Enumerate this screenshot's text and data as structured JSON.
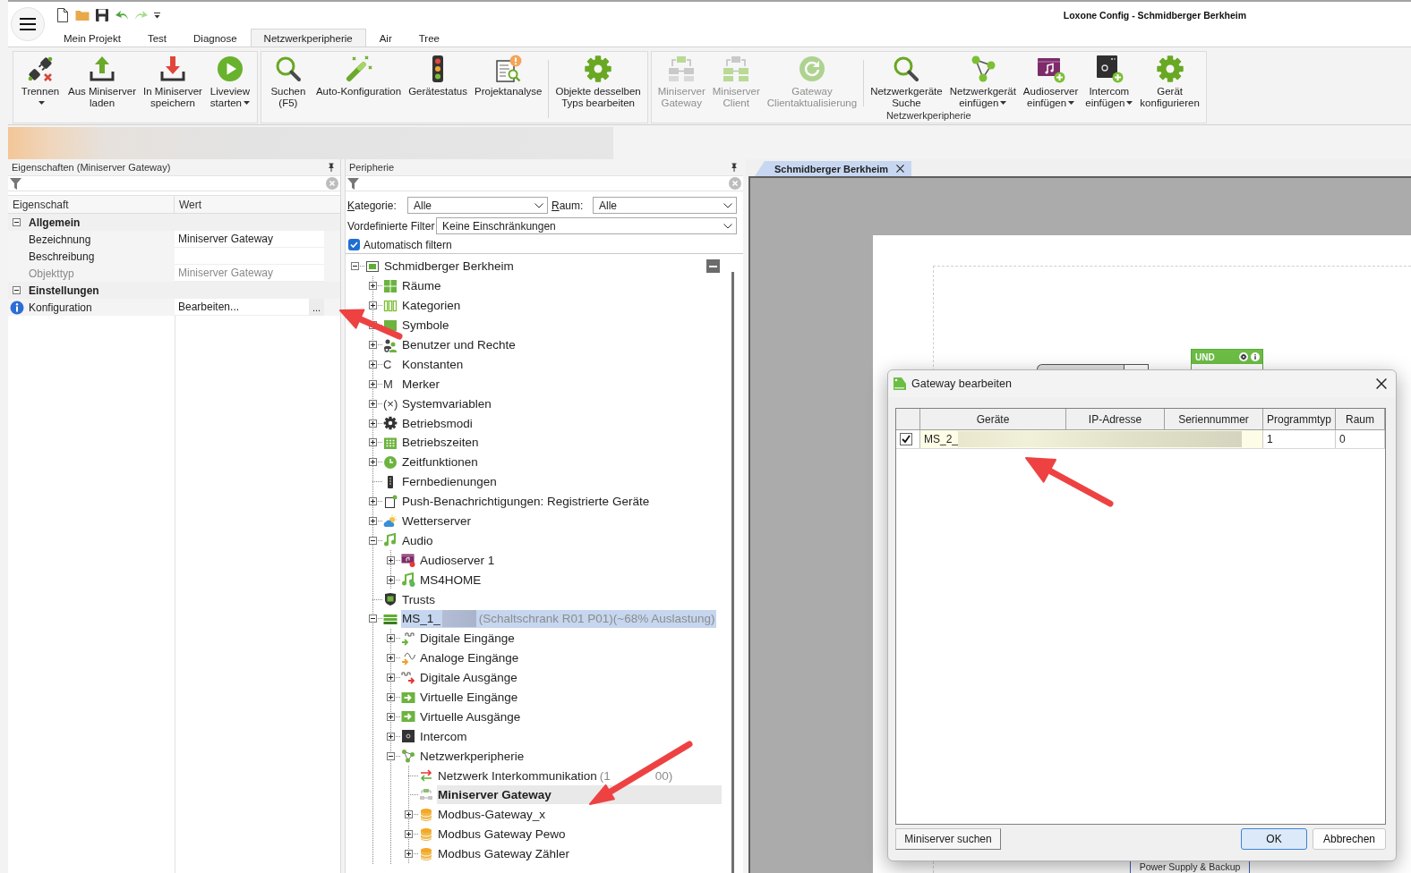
{
  "window": {
    "title": "Loxone Config - Schmidberger Berkheim"
  },
  "ribbon_tabs": [
    {
      "label": "Mein Projekt",
      "selected": false
    },
    {
      "label": "Test",
      "selected": false
    },
    {
      "label": "Diagnose",
      "selected": false
    },
    {
      "label": "Netzwerkperipherie",
      "selected": true
    },
    {
      "label": "Air",
      "selected": false
    },
    {
      "label": "Tree",
      "selected": false
    }
  ],
  "ribbon": {
    "groups": [
      {
        "sections": [
          {
            "buttons": [
              {
                "lines": [
                  "Trennen"
                ],
                "dropdown": true,
                "disabled": false
              },
              {
                "lines": [
                  "Aus Miniserver",
                  "laden"
                ],
                "dropdown": false,
                "disabled": false
              },
              {
                "lines": [
                  "In Miniserver",
                  "speichern"
                ],
                "dropdown": false,
                "disabled": false
              },
              {
                "lines": [
                  "Liveview",
                  "starten"
                ],
                "dropdown": true,
                "disabled": false
              }
            ]
          }
        ]
      },
      {
        "sections": [
          {
            "buttons": [
              {
                "lines": [
                  "Suchen",
                  "(F5)"
                ],
                "dropdown": false,
                "disabled": false
              },
              {
                "lines": [
                  "Auto-Konfiguration"
                ],
                "dropdown": false,
                "disabled": false
              },
              {
                "lines": [
                  "Gerätestatus"
                ],
                "dropdown": false,
                "disabled": false
              },
              {
                "lines": [
                  "Projektanalyse"
                ],
                "dropdown": false,
                "disabled": false
              }
            ]
          },
          {
            "buttons": [
              {
                "lines": [
                  "Objekte desselben",
                  "Typs bearbeiten"
                ],
                "dropdown": false,
                "disabled": false
              }
            ]
          }
        ]
      },
      {
        "label": "Netzwerkperipherie",
        "sections": [
          {
            "buttons": [
              {
                "lines": [
                  "Miniserver",
                  "Gateway"
                ],
                "dropdown": false,
                "disabled": true
              },
              {
                "lines": [
                  "Miniserver",
                  "Client"
                ],
                "dropdown": false,
                "disabled": true
              },
              {
                "lines": [
                  "Gateway",
                  "Clientaktualisierung"
                ],
                "dropdown": false,
                "disabled": true
              }
            ]
          },
          {
            "buttons": [
              {
                "lines": [
                  "Netzwerkgeräte",
                  "Suche"
                ],
                "dropdown": false,
                "disabled": false
              },
              {
                "lines": [
                  "Netzwerkgerät",
                  "einfügen"
                ],
                "dropdown": true,
                "disabled": false
              },
              {
                "lines": [
                  "Audioserver",
                  "einfügen"
                ],
                "dropdown": true,
                "disabled": false
              },
              {
                "lines": [
                  "Intercom",
                  "einfügen"
                ],
                "dropdown": true,
                "disabled": false
              },
              {
                "lines": [
                  "Gerät",
                  "konfigurieren"
                ],
                "dropdown": false,
                "disabled": false
              }
            ]
          }
        ]
      }
    ]
  },
  "properties": {
    "title": "Eigenschaften (Miniserver Gateway)",
    "columns": [
      "Eigenschaft",
      "Wert"
    ],
    "categories": [
      {
        "label": "Allgemein",
        "expanded": true,
        "rows": [
          {
            "kind": "text",
            "name": "Bezeichnung",
            "value": "Miniserver Gateway",
            "disabled": false
          },
          {
            "kind": "text",
            "name": "Beschreibung",
            "disabled": false
          },
          {
            "kind": "text",
            "name": "Objekttyp",
            "value": "Miniserver Gateway",
            "disabled": true
          }
        ]
      },
      {
        "label": "Einstellungen",
        "expanded": true,
        "rows": [
          {
            "kind": "editor",
            "name": "Konfiguration",
            "value": "Bearbeiten...",
            "button": "...",
            "disabled": false
          }
        ]
      }
    ]
  },
  "peripherie": {
    "title": "Peripherie",
    "category_filter": {
      "label": "Kategorie:",
      "value": "Alle"
    },
    "room_filter": {
      "label": "Raum:",
      "value": "Alle"
    },
    "predefined_filter": {
      "label": "Vordefinierte Filter",
      "value": "Keine Einschränkungen"
    },
    "auto_filter": {
      "label": "Automatisch filtern",
      "checked": true
    },
    "tree": [
      {
        "label": "Schmidberger Berkheim",
        "expanded": true,
        "selected": false,
        "highlighted": false,
        "children": [
          {
            "label": "Räume",
            "expanded": false,
            "selected": false,
            "highlighted": false
          },
          {
            "label": "Kategorien",
            "expanded": false,
            "selected": false,
            "highlighted": false
          },
          {
            "label": "Symbole",
            "expanded": false,
            "selected": false,
            "highlighted": false
          },
          {
            "label": "Benutzer und Rechte",
            "expanded": false,
            "selected": false,
            "highlighted": false
          },
          {
            "label": "Konstanten",
            "glyph": "C",
            "expanded": false,
            "selected": false,
            "highlighted": false
          },
          {
            "label": "Merker",
            "glyph": "M",
            "expanded": false,
            "selected": false,
            "highlighted": false
          },
          {
            "label": "Systemvariablen",
            "glyph": "(×)",
            "expanded": false,
            "selected": false,
            "highlighted": false
          },
          {
            "label": "Betriebsmodi",
            "expanded": false,
            "selected": false,
            "highlighted": false
          },
          {
            "label": "Betriebszeiten",
            "expanded": false,
            "selected": false,
            "highlighted": false
          },
          {
            "label": "Zeitfunktionen",
            "expanded": false,
            "selected": false,
            "highlighted": false
          },
          {
            "label": "Fernbedienungen",
            "selected": false,
            "highlighted": false
          },
          {
            "label": "Push-Benachrichtigungen: Registrierte Geräte",
            "expanded": false,
            "selected": false,
            "highlighted": false
          },
          {
            "label": "Wetterserver",
            "expanded": false,
            "selected": false,
            "highlighted": false
          },
          {
            "label": "Audio",
            "expanded": true,
            "selected": false,
            "highlighted": false,
            "children": [
              {
                "label": "Audioserver 1",
                "expanded": false,
                "selected": false,
                "highlighted": false
              },
              {
                "label": "MS4HOME",
                "expanded": false,
                "selected": false,
                "highlighted": false
              }
            ]
          },
          {
            "label": "Trusts",
            "selected": false,
            "highlighted": false
          },
          {
            "label": "MS_1_",
            "redacted": true,
            "note_parts": [
              "(Schaltschrank R01 P01)(~68% Auslastung)"
            ],
            "expanded": true,
            "selected": false,
            "highlighted": true,
            "children": [
              {
                "label": "Digitale Eingänge",
                "expanded": false,
                "selected": false,
                "highlighted": false
              },
              {
                "label": "Analoge Eingänge",
                "expanded": false,
                "selected": false,
                "highlighted": false
              },
              {
                "label": "Digitale Ausgänge",
                "expanded": false,
                "selected": false,
                "highlighted": false
              },
              {
                "label": "Virtuelle Eingänge",
                "expanded": false,
                "selected": false,
                "highlighted": false
              },
              {
                "label": "Virtuelle Ausgänge",
                "expanded": false,
                "selected": false,
                "highlighted": false
              },
              {
                "label": "Intercom",
                "expanded": false,
                "selected": false,
                "highlighted": false
              },
              {
                "label": "Netzwerkperipherie",
                "expanded": true,
                "selected": false,
                "highlighted": false,
                "children": [
                  {
                    "label": "Netzwerk Interkommunikation",
                    "note_parts": [
                      "(1",
                      "00)"
                    ],
                    "selected": false,
                    "highlighted": false
                  },
                  {
                    "label": "Miniserver Gateway",
                    "selected": true,
                    "highlighted": false
                  },
                  {
                    "label": "Modbus-Gateway_x",
                    "expanded": false,
                    "selected": false,
                    "highlighted": false
                  },
                  {
                    "label": "Modbus Gateway Pewo",
                    "expanded": false,
                    "selected": false,
                    "highlighted": false
                  },
                  {
                    "label": "Modbus Gateway Zähler",
                    "expanded": false,
                    "selected": false,
                    "highlighted": false
                  }
                ]
              }
            ]
          }
        ]
      }
    ]
  },
  "document_tabs": [
    {
      "label": "Schmidberger Berkheim",
      "selected": true
    }
  ],
  "canvas": {
    "blocks": [
      {
        "kind": "logic",
        "title": "UND"
      },
      {
        "kind": "input"
      },
      {
        "kind": "label",
        "title": "Power Supply & Backup"
      }
    ]
  },
  "dialog": {
    "title": "Gateway bearbeiten",
    "columns": [
      "Geräte",
      "IP-Adresse",
      "Seriennummer",
      "Programmtyp",
      "Raum"
    ],
    "rows": [
      {
        "checked": true,
        "device": "MS_2_",
        "redacted": true,
        "program_type": "1",
        "room": "0"
      }
    ],
    "search_button": "Miniserver suchen",
    "buttons": [
      {
        "label": "OK",
        "default": true
      },
      {
        "label": "Abbrechen",
        "default": false
      }
    ]
  }
}
